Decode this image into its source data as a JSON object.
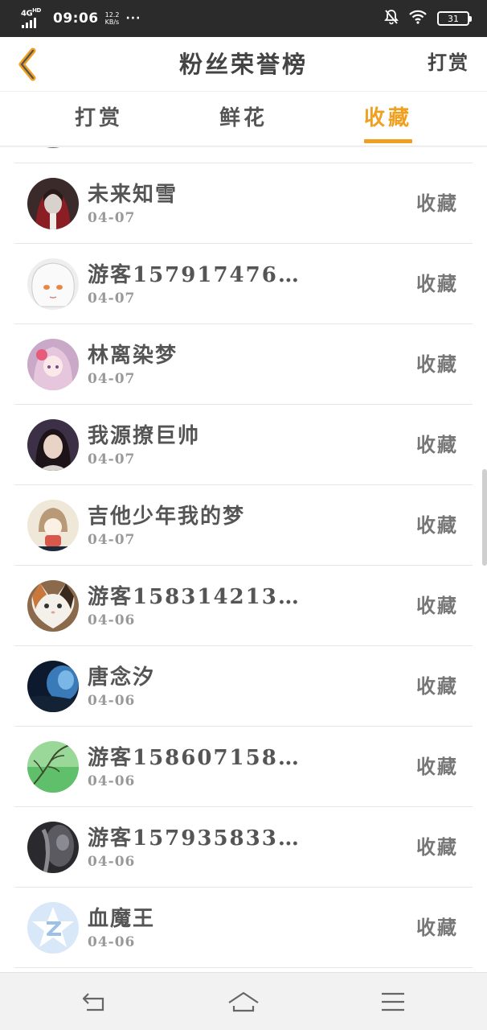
{
  "status_bar": {
    "network": "4G",
    "network_sup": "HD",
    "time": "09:06",
    "speed_value": "12.2",
    "speed_unit": "KB/s",
    "more": "···",
    "battery": "31"
  },
  "header": {
    "title": "粉丝荣誉榜",
    "action": "打赏",
    "back_icon": "chevron-left-icon",
    "accent_color": "#f0a020"
  },
  "tabs": [
    {
      "label": "打赏",
      "active": false
    },
    {
      "label": "鲜花",
      "active": false
    },
    {
      "label": "收藏",
      "active": true
    }
  ],
  "fans": [
    {
      "name": "未来知雪",
      "date": "04-07",
      "action": "收藏"
    },
    {
      "name": "游客157917476…",
      "date": "04-07",
      "action": "收藏"
    },
    {
      "name": "林离染梦",
      "date": "04-07",
      "action": "收藏"
    },
    {
      "name": "我源撩巨帅",
      "date": "04-07",
      "action": "收藏"
    },
    {
      "name": "吉他少年我的梦",
      "date": "04-07",
      "action": "收藏"
    },
    {
      "name": "游客158314213…",
      "date": "04-06",
      "action": "收藏"
    },
    {
      "name": "唐念汐",
      "date": "04-06",
      "action": "收藏"
    },
    {
      "name": "游客158607158…",
      "date": "04-06",
      "action": "收藏"
    },
    {
      "name": "游客157935833…",
      "date": "04-06",
      "action": "收藏"
    },
    {
      "name": "血魔王",
      "date": "04-06",
      "action": "收藏"
    }
  ],
  "nav": {
    "back_icon": "back-arrow-icon",
    "home_icon": "home-icon",
    "menu_icon": "menu-icon"
  }
}
